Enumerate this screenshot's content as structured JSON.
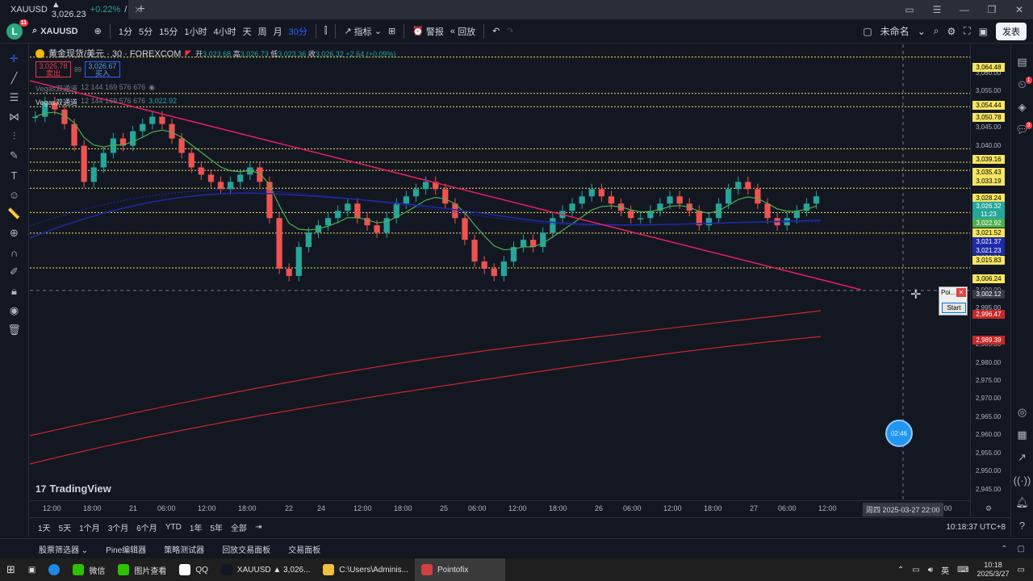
{
  "browser": {
    "tab_title": "XAUUSD",
    "tab_price": "▲ 3,026.23",
    "tab_change": "+0.22%",
    "tab_suffix": "/"
  },
  "toolbar": {
    "avatar_letter": "L",
    "avatar_badge": "11",
    "symbol": "XAUUSD",
    "intervals": [
      "1分",
      "5分",
      "15分",
      "1小时",
      "4小时",
      "天",
      "周",
      "月",
      "30分"
    ],
    "active_interval": "30分",
    "indicators_label": "指标",
    "alert_label": "警报",
    "replay_label": "回放",
    "layout_name": "未命名",
    "publish_label": "发表"
  },
  "legend": {
    "title": "黄金现货/美元 · 30 · FOREXCOM",
    "open_label": "开",
    "open": "3,023.68",
    "high_label": "高",
    "high": "3,026.73",
    "low_label": "低",
    "low": "3,023.36",
    "close_label": "收",
    "close": "3,026.32",
    "change": "+2.64 (+0.09%)",
    "sell_price": "3,025.78",
    "sell_label": "卖出",
    "spread": "89",
    "buy_price": "3,026.67",
    "buy_label": "买入",
    "indicator1_name": "Vegas双通道",
    "indicator1_params": "12 144 169 576 676",
    "indicator2_name": "Vegas双通道",
    "indicator2_params": "12 144 169 576 676",
    "indicator2_val1": "3,022.92"
  },
  "price_axis": {
    "labels": [
      "3,060.00",
      "3,055.00",
      "3,045.00",
      "3,040.00",
      "3,030.00",
      "3,010.00",
      "3,000.00",
      "2,995.00",
      "2,985.00",
      "2,980.00",
      "2,975.00",
      "2,970.00",
      "2,965.00",
      "2,960.00",
      "2,955.00",
      "2,950.00",
      "2,945.00"
    ],
    "tags": [
      {
        "text": "3,064.48",
        "color": "#f5e663",
        "fg": "#000000"
      },
      {
        "text": "3,054.44",
        "color": "#f5e663",
        "fg": "#000000"
      },
      {
        "text": "3,050.78",
        "color": "#f5e663",
        "fg": "#000000"
      },
      {
        "text": "3,039.16",
        "color": "#f5e663",
        "fg": "#000000"
      },
      {
        "text": "3,035.43",
        "color": "#f5e663",
        "fg": "#000000"
      },
      {
        "text": "3,033.19",
        "color": "#f5e663",
        "fg": "#000000"
      },
      {
        "text": "3,028.24",
        "color": "#f5e663",
        "fg": "#000000"
      },
      {
        "text": "3,026.32",
        "color": "#26a69a",
        "fg": "#ffffff"
      },
      {
        "text": "11:23",
        "color": "#26a69a",
        "fg": "#ffffff"
      },
      {
        "text": "3,022.92",
        "color": "#4caf50",
        "fg": "#ffffff"
      },
      {
        "text": "3,021.52",
        "color": "#f5e663",
        "fg": "#000000"
      },
      {
        "text": "3,021.37",
        "color": "#1e2aa8",
        "fg": "#ffffff"
      },
      {
        "text": "3,021.23",
        "color": "#1e2aa8",
        "fg": "#ffffff"
      },
      {
        "text": "3,015.83",
        "color": "#f5e663",
        "fg": "#000000"
      },
      {
        "text": "3,006.24",
        "color": "#f5e663",
        "fg": "#000000"
      },
      {
        "text": "3,002.12",
        "color": "#363a45",
        "fg": "#ffffff"
      },
      {
        "text": "2,996.47",
        "color": "#c62828",
        "fg": "#ffffff"
      },
      {
        "text": "2,989.39",
        "color": "#c62828",
        "fg": "#ffffff"
      }
    ]
  },
  "time_axis": {
    "labels": [
      "12:00",
      "18:00",
      "21",
      "06:00",
      "12:00",
      "18:00",
      "22",
      "24",
      "12:00",
      "18:00",
      "25",
      "06:00",
      "12:00",
      "18:00",
      "26",
      "06:00",
      "12:00",
      "18:00",
      "27",
      "06:00",
      "12:00",
      "06:00"
    ],
    "crosshair": "周四 2025-03-27   22:00"
  },
  "ranges": {
    "items": [
      "1天",
      "5天",
      "1个月",
      "3个月",
      "6个月",
      "YTD",
      "1年",
      "5年",
      "全部"
    ],
    "clock": "10:18:37 UTC+8"
  },
  "panels": {
    "items": [
      "股票筛选器",
      "Pine编辑器",
      "策略测试器",
      "回放交易面板",
      "交易面板"
    ]
  },
  "widget": {
    "title": "Poi...",
    "start_label": "Start",
    "countdown": "02:46"
  },
  "watermark": "TradingView",
  "taskbar": {
    "apps": [
      {
        "label": "微信",
        "color": "#2dc100"
      },
      {
        "label": "图片查看",
        "color": "#2dc100"
      },
      {
        "label": "QQ",
        "color": "#ffffff"
      },
      {
        "label": "XAUUSD ▲ 3,026...",
        "color": "#131722"
      },
      {
        "label": "C:\\Users\\Adminis...",
        "color": "#f0c040"
      },
      {
        "label": "Pointofix",
        "color": "#d04040"
      }
    ],
    "ime": "英",
    "time": "10:18",
    "date": "2025/3/27"
  },
  "chart_data": {
    "type": "line",
    "ylim": [
      2942,
      3068
    ],
    "candles_approx": [
      3048,
      3052,
      3050,
      3046,
      3040,
      3030,
      3034,
      3038,
      3042,
      3040,
      3044,
      3046,
      3048,
      3046,
      3042,
      3038,
      3034,
      3032,
      3030,
      3028,
      3030,
      3032,
      3034,
      3030,
      3020,
      3006,
      3004,
      3012,
      3016,
      3018,
      3020,
      3022,
      3024,
      3020,
      3018,
      3016,
      3020,
      3024,
      3026,
      3028,
      3030,
      3028,
      3024,
      3020,
      3014,
      3008,
      3006,
      3004,
      3008,
      3012,
      3014,
      3012,
      3016,
      3020,
      3022,
      3024,
      3026,
      3028,
      3026,
      3024,
      3022,
      3020,
      3020,
      3022,
      3024,
      3026,
      3024,
      3022,
      3018,
      3020,
      3024,
      3028,
      3030,
      3028,
      3024,
      3020,
      3018,
      3020,
      3022,
      3024,
      3026
    ],
    "horizontal_levels": [
      3064.48,
      3054.44,
      3050.78,
      3039.16,
      3035.43,
      3033.19,
      3028.24,
      3021.52,
      3015.83,
      3006.24
    ]
  },
  "colors": {
    "up": "#26a69a",
    "down": "#ef5350",
    "level_line": "#f5e663",
    "trendline": "#e91e63",
    "ema_fast": "#4caf50",
    "ema_mid": "#1e2aa8",
    "channel": "#c62828"
  }
}
